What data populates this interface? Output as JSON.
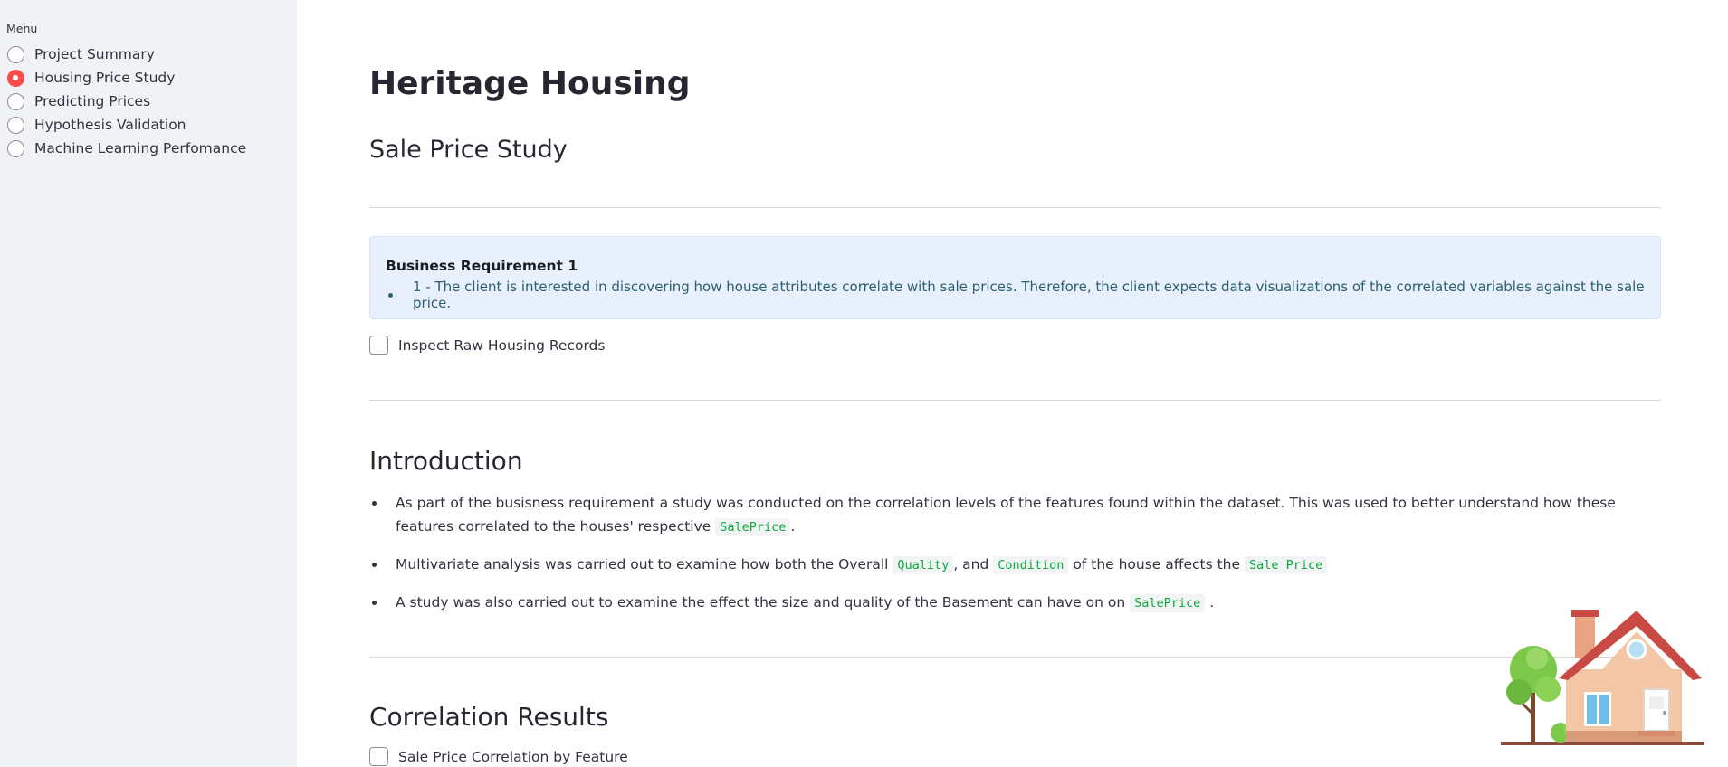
{
  "sidebar": {
    "menu_label": "Menu",
    "items": [
      {
        "label": "Project Summary",
        "selected": false
      },
      {
        "label": "Housing Price Study",
        "selected": true
      },
      {
        "label": "Predicting Prices",
        "selected": false
      },
      {
        "label": "Hypothesis Validation",
        "selected": false
      },
      {
        "label": "Machine Learning Perfomance",
        "selected": false
      }
    ]
  },
  "main": {
    "title": "Heritage Housing",
    "subtitle": "Sale Price Study",
    "info_box": {
      "heading": "Business Requirement 1",
      "bullet": "1 - The client is interested in discovering how house attributes correlate with sale prices. Therefore, the client expects data visualizations of the correlated variables against the sale price."
    },
    "checkbox_raw": "Inspect Raw Housing Records",
    "introduction": {
      "heading": "Introduction",
      "bullet1_text": "As part of the busisness requirement a study was conducted on the correlation levels of the features found within the dataset. This was used to better understand how these features correlated to the houses' respective",
      "bullet1_code": "SalePrice",
      "bullet1_end": ".",
      "bullet2_text_a": "Multivariate analysis was carried out to examine how both the Overall",
      "bullet2_code_a": "Quality",
      "bullet2_text_b": ", and",
      "bullet2_code_b": "Condition",
      "bullet2_text_c": "of the house affects the",
      "bullet2_code_c": "Sale Price",
      "bullet3_text": "A study was also carried out to examine the effect the size and quality of the Basement can have on on",
      "bullet3_code": "SalePrice",
      "bullet3_end": "."
    },
    "correlation": {
      "heading": "Correlation Results",
      "checkbox_label": "Sale Price Correlation by Feature"
    }
  },
  "colors": {
    "accent": "#ff4b4b",
    "sidebar_bg": "#f0f2f6",
    "info_bg": "#e8f1fb",
    "code_text": "#09ab3b"
  }
}
